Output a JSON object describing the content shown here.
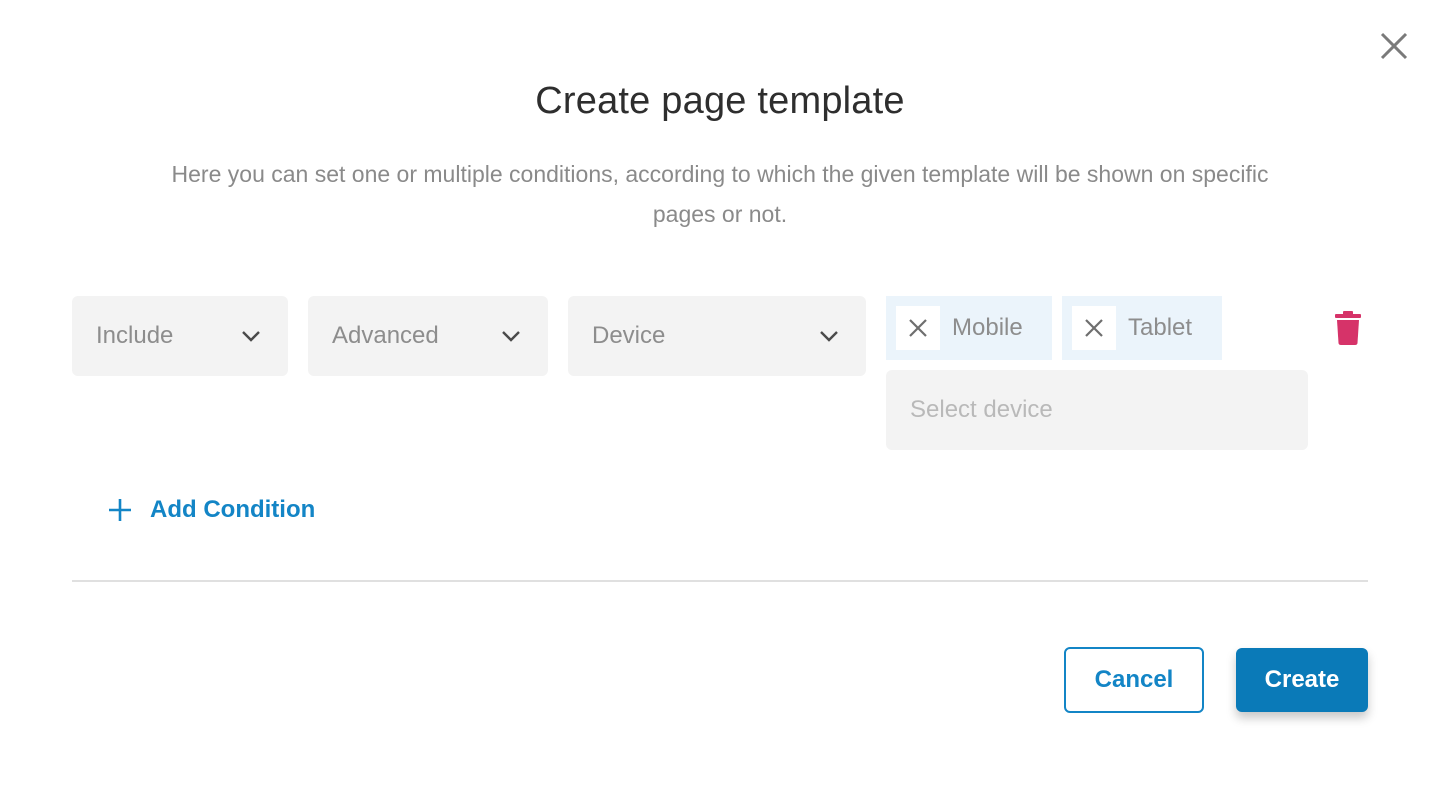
{
  "dialog": {
    "title": "Create page template",
    "description": "Here you can set one or multiple conditions, according to which the given template will be shown on specific pages or not.",
    "close_icon": "close-icon"
  },
  "condition": {
    "type_select": {
      "value": "Include",
      "icon": "chevron-down-icon"
    },
    "category_select": {
      "value": "Advanced",
      "icon": "chevron-down-icon"
    },
    "field_select": {
      "value": "Device",
      "icon": "chevron-down-icon"
    },
    "selected_devices": [
      {
        "label": "Mobile",
        "remove_icon": "close-icon"
      },
      {
        "label": "Tablet",
        "remove_icon": "close-icon"
      }
    ],
    "device_input": {
      "value": "",
      "placeholder": "Select device"
    },
    "delete_icon": "trash-icon"
  },
  "add_condition": {
    "label": "Add Condition",
    "icon": "plus-icon"
  },
  "footer": {
    "cancel_label": "Cancel",
    "create_label": "Create"
  },
  "colors": {
    "primary": "#0a7ab8",
    "link": "#1385c6",
    "danger": "#d63369",
    "chip_bg": "#ebf4fb",
    "field_bg": "#f3f3f3"
  }
}
